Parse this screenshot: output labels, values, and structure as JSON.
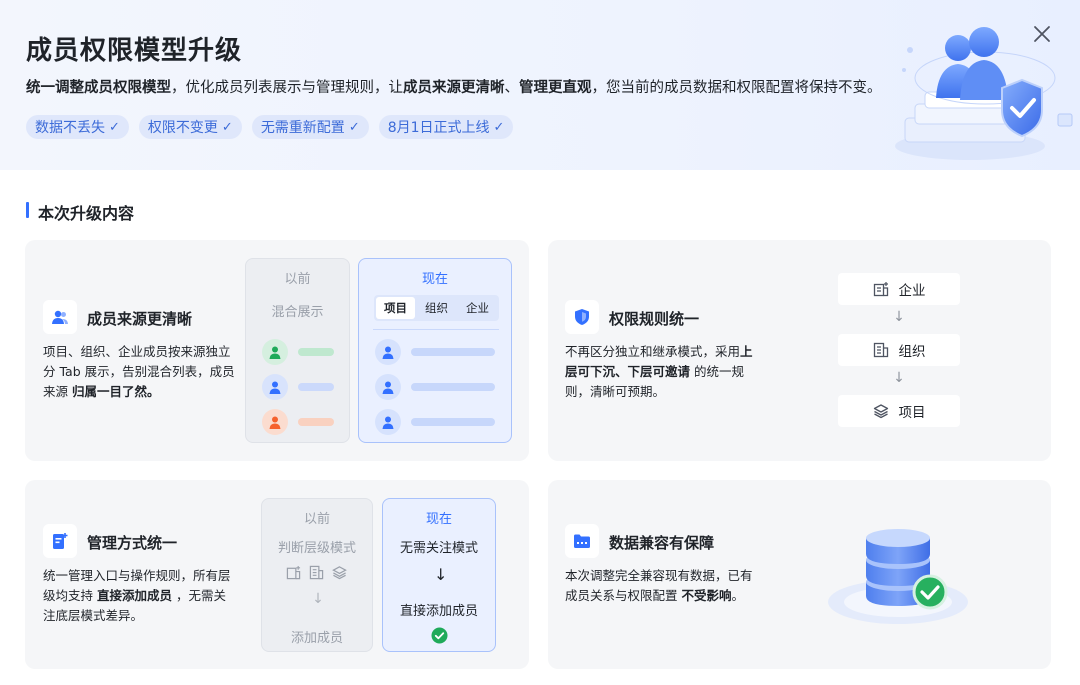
{
  "header": {
    "title": "成员权限模型升级",
    "subtitle": [
      {
        "text": "统一调整成员权限模型",
        "bold": true
      },
      {
        "text": "，优化成员列表展示与管理规则，让",
        "bold": false
      },
      {
        "text": "成员来源更清晰",
        "bold": true
      },
      {
        "text": "、",
        "bold": false
      },
      {
        "text": "管理更直观",
        "bold": true
      },
      {
        "text": "，您当前的成员数据和权限配置将保持不变。",
        "bold": false
      }
    ],
    "chips": [
      "数据不丢失",
      "权限不变更",
      "无需重新配置",
      "8月1日正式上线"
    ],
    "close_icon": "close-icon"
  },
  "section": {
    "title": "本次升级内容"
  },
  "features": {
    "source": {
      "icon": "users-icon",
      "title": "成员来源更清晰",
      "desc_plain": "项目、组织、企业成员按来源独立分 Tab 展示，告别混合列表，成员来源 ",
      "desc_bold": "归属一目了然。",
      "before_label": "以前",
      "before_sub": "混合展示",
      "now_label": "现在",
      "tabs": [
        "项目",
        "组织",
        "企业"
      ],
      "avatar_colors_before": [
        "#1faa5a",
        "#3370ff",
        "#f5622e"
      ],
      "avatar_colors_now": [
        "#3370ff",
        "#3370ff",
        "#3370ff"
      ]
    },
    "rules": {
      "icon": "shield-icon",
      "title": "权限规则统一",
      "desc_line1": "不再区分独立和继承模式，采用",
      "desc_bold": "上层可下沉、下层可邀请",
      "desc_line2": " 的统一规则，清晰可预期。",
      "nodes": [
        {
          "icon": "enterprise-icon",
          "label": "企业"
        },
        {
          "icon": "organization-icon",
          "label": "组织"
        },
        {
          "icon": "project-icon",
          "label": "项目"
        }
      ]
    },
    "manage": {
      "icon": "manage-icon",
      "title": "管理方式统一",
      "desc_a": "统一管理入口与操作规则，所有层级均支持 ",
      "desc_bold": "直接添加成员",
      "desc_b": " ，无需关注底层模式差异。",
      "before_label": "以前",
      "before_sub": "判断层级模式",
      "before_result": "添加成员",
      "now_label": "现在",
      "now_sub": "无需关注模式",
      "now_result": "直接添加成员"
    },
    "compat": {
      "icon": "data-icon",
      "title": "数据兼容有保障",
      "desc_a": "本次调整完全兼容现有数据，已有成员关系与权限配置 ",
      "desc_bold": "不受影响",
      "desc_b": "。"
    }
  },
  "colors": {
    "accent": "#3370ff",
    "card_bg": "#f5f6f8",
    "chip_bg": "#dfe7fb",
    "success": "#1faa5a"
  }
}
